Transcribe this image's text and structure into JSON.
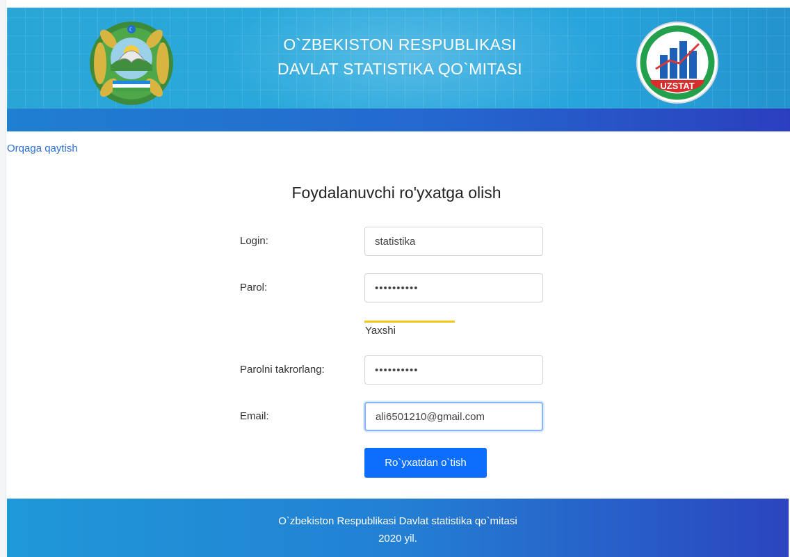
{
  "header": {
    "title_line1": "O`ZBEKISTON RESPUBLIKASI",
    "title_line2": "DAVLAT STATISTIKA QO`MITASI",
    "uzstat_label": "UZSTAT",
    "brand_color": "#29a9dd",
    "band_color": "#2468cf"
  },
  "nav": {
    "back_link": "Orqaga qaytish"
  },
  "form": {
    "title": "Foydalanuvchi ro'yxatga olish",
    "login_label": "Login:",
    "login_value": "statistika",
    "password_label": "Parol:",
    "password_value": "••••••••••",
    "strength_label": "Yaxshi",
    "strength_color": "#f2c81a",
    "password_confirm_label": "Parolni takrorlang:",
    "password_confirm_value": "••••••••••",
    "email_label": "Email:",
    "email_value": "ali6501210@gmail.com",
    "submit_label": "Ro`yxatdan o`tish",
    "submit_color": "#0d6efd"
  },
  "footer": {
    "line1": "O`zbekiston Respublikasi Davlat statistika qo`mitasi",
    "line2": "2020 yil."
  }
}
